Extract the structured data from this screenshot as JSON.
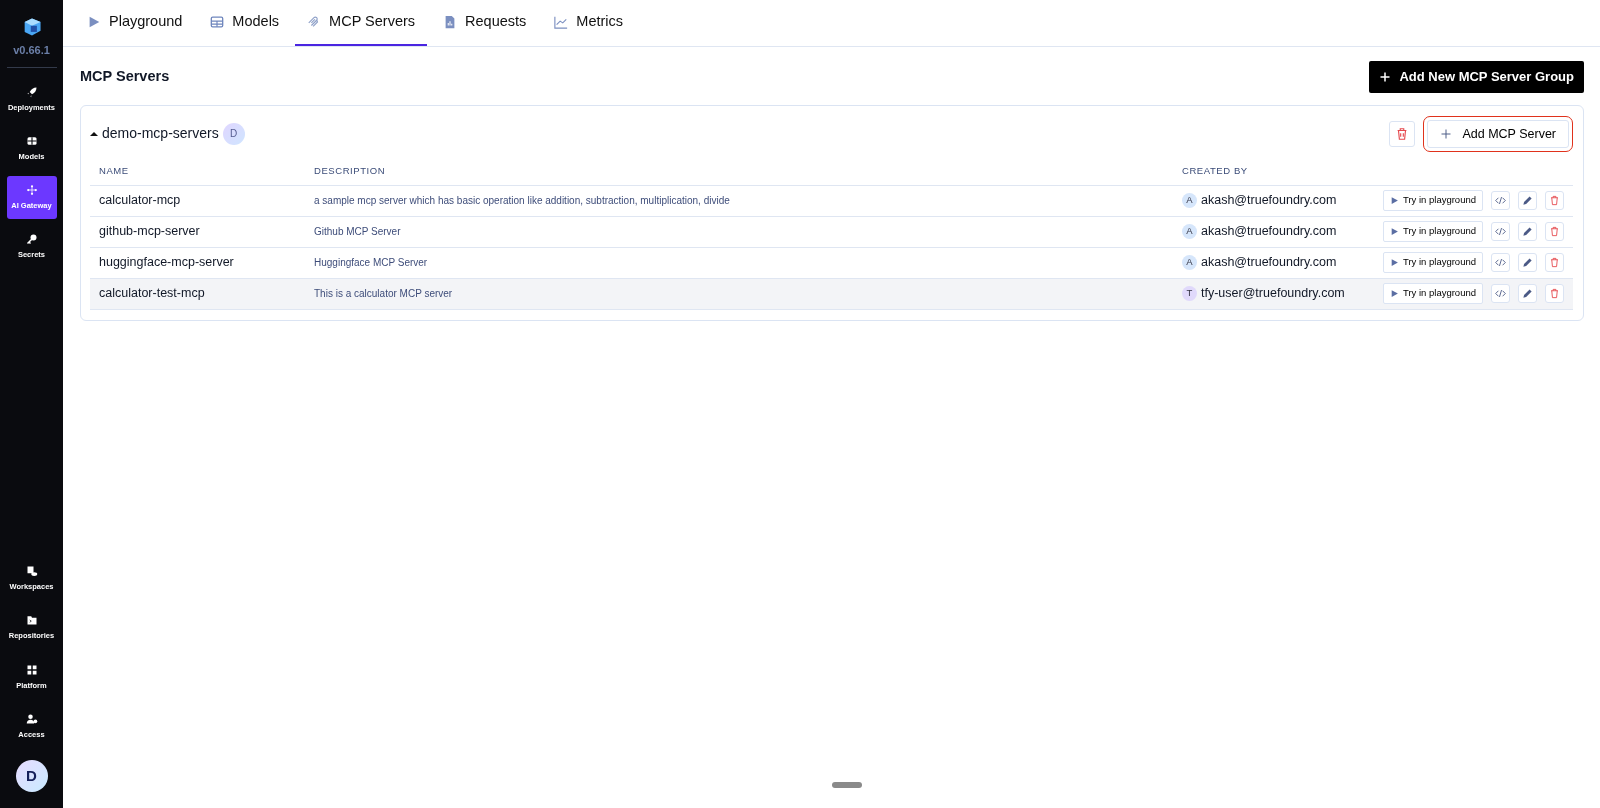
{
  "sidebar": {
    "version": "v0.66.1",
    "top_items": [
      {
        "label": "Deployments",
        "selected": false
      },
      {
        "label": "Models",
        "selected": false
      },
      {
        "label": "AI Gateway",
        "selected": true
      },
      {
        "label": "Secrets",
        "selected": false
      }
    ],
    "bottom_items": [
      {
        "label": "Workspaces",
        "selected": false
      },
      {
        "label": "Repositories",
        "selected": false
      },
      {
        "label": "Platform",
        "selected": false
      },
      {
        "label": "Access",
        "selected": false
      }
    ],
    "avatar": "D"
  },
  "tabs": [
    {
      "label": "Playground",
      "selected": false
    },
    {
      "label": "Models",
      "selected": false
    },
    {
      "label": "MCP Servers",
      "selected": true
    },
    {
      "label": "Requests",
      "selected": false
    },
    {
      "label": "Metrics",
      "selected": false
    }
  ],
  "page_title": "MCP Servers",
  "add_group_button": "Add New MCP Server Group",
  "group": {
    "name": "demo-mcp-servers",
    "expanded": true,
    "avatar": "D",
    "add_button": {
      "label": "Add MCP Server",
      "annotated": true
    },
    "columns": [
      "NAME",
      "DESCRIPTION",
      "CREATED BY"
    ],
    "rows": [
      {
        "name": "calculator-mcp",
        "description": "a sample mcp server which has basic operation like addition, subtraction, multiplication, divide",
        "avatar": "A",
        "created_by": "akash@truefoundry.com",
        "action": "Try in playground",
        "highlighted": false
      },
      {
        "name": "github-mcp-server",
        "description": "Github MCP Server",
        "avatar": "A",
        "created_by": "akash@truefoundry.com",
        "action": "Try in playground",
        "highlighted": false
      },
      {
        "name": "huggingface-mcp-server",
        "description": "Huggingface MCP Server",
        "avatar": "A",
        "created_by": "akash@truefoundry.com",
        "action": "Try in playground",
        "highlighted": false
      },
      {
        "name": "calculator-test-mcp",
        "description": "This is a calculator MCP server",
        "avatar": "T",
        "created_by": "tfy-user@truefoundry.com",
        "action": "Try in playground",
        "highlighted": true
      }
    ]
  }
}
